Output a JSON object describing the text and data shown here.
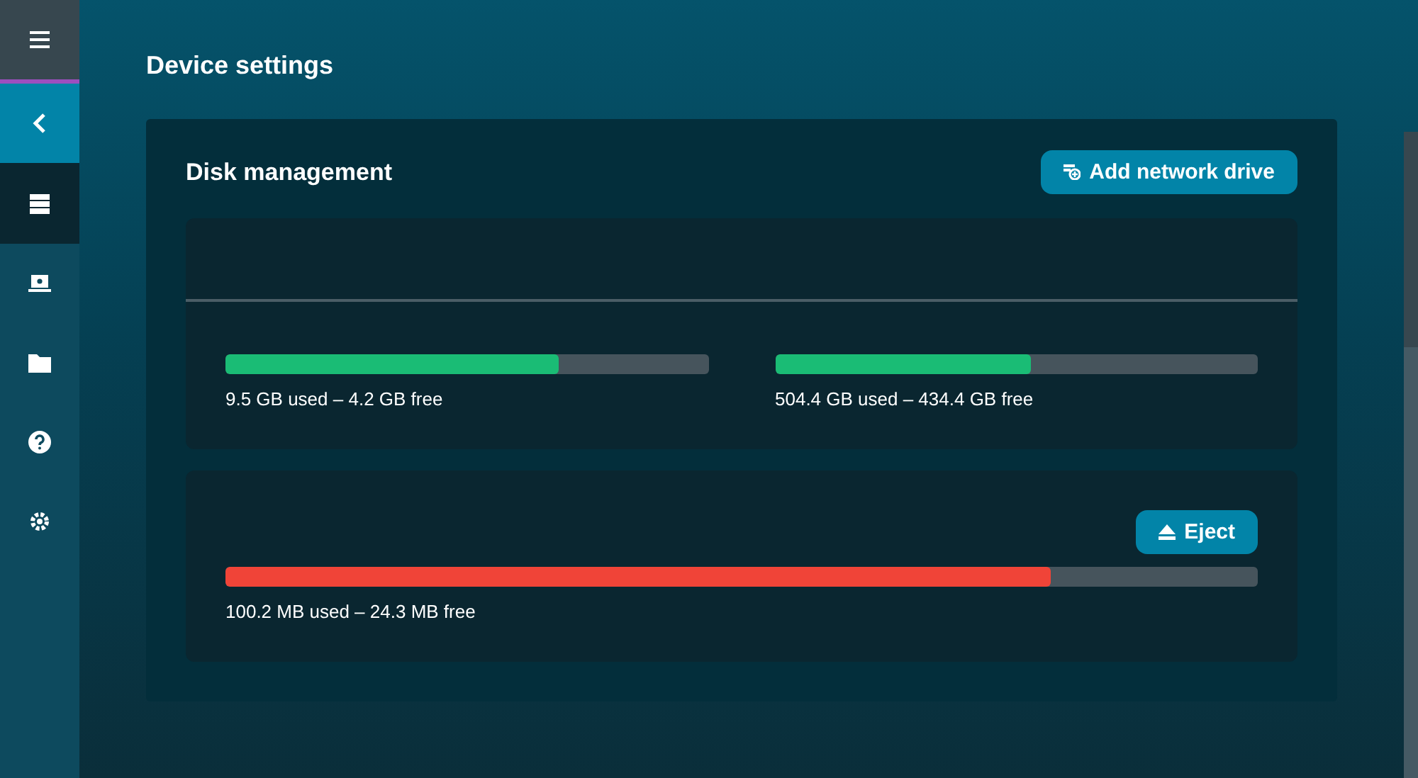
{
  "sidebar": {
    "items": [
      {
        "kind": "menu",
        "selected": false
      },
      {
        "kind": "back",
        "selected": false
      },
      {
        "kind": "storage",
        "selected": true
      },
      {
        "kind": "device",
        "selected": false
      },
      {
        "kind": "folder",
        "selected": false
      },
      {
        "kind": "help",
        "selected": false
      },
      {
        "kind": "settings",
        "selected": false
      }
    ]
  },
  "page_title": "Device settings",
  "disk_management": {
    "title": "Disk management",
    "add_button": "Add network drive",
    "groups": [
      {
        "disks": [
          {
            "level": 0.69,
            "color": "#1abc75",
            "usage": "9.5 GB used – 4.2 GB free"
          },
          {
            "level": 0.53,
            "color": "#1abc75",
            "usage": "504.4 GB used – 434.4 GB free"
          }
        ]
      },
      {
        "eject_button": "Eject",
        "disks": [
          {
            "level": 0.8,
            "color": "#f04438",
            "usage": "100.2 MB used – 24.3 MB free"
          }
        ]
      }
    ]
  }
}
